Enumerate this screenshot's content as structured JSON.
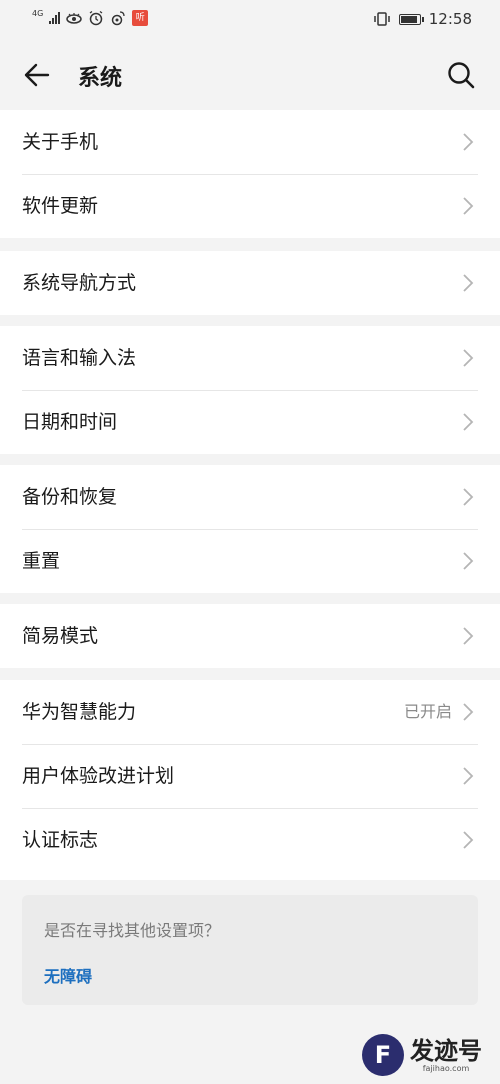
{
  "status_bar": {
    "network": "4G",
    "time": "12:58",
    "listen_badge": "听"
  },
  "header": {
    "title": "系统"
  },
  "groups": [
    {
      "items": [
        {
          "label": "关于手机",
          "value": ""
        },
        {
          "label": "软件更新",
          "value": ""
        }
      ]
    },
    {
      "items": [
        {
          "label": "系统导航方式",
          "value": ""
        }
      ]
    },
    {
      "items": [
        {
          "label": "语言和输入法",
          "value": ""
        },
        {
          "label": "日期和时间",
          "value": ""
        }
      ]
    },
    {
      "items": [
        {
          "label": "备份和恢复",
          "value": ""
        },
        {
          "label": "重置",
          "value": ""
        }
      ]
    },
    {
      "items": [
        {
          "label": "简易模式",
          "value": ""
        }
      ]
    },
    {
      "items": [
        {
          "label": "华为智慧能力",
          "value": "已开启"
        },
        {
          "label": "用户体验改进计划",
          "value": ""
        },
        {
          "label": "认证标志",
          "value": ""
        }
      ]
    }
  ],
  "tip": {
    "question": "是否在寻找其他设置项？",
    "link": "无障碍"
  },
  "watermark": {
    "logo": "F",
    "name": "发迹号",
    "domain": "fajihao.com"
  }
}
